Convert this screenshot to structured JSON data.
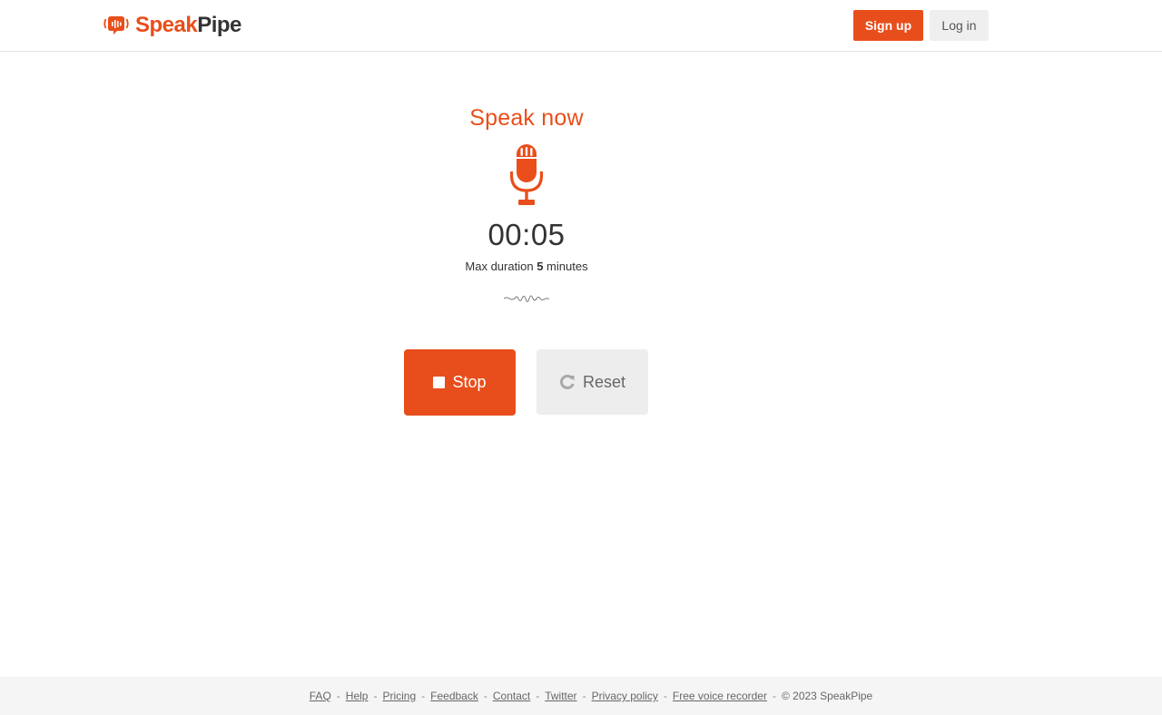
{
  "header": {
    "logo_speak": "Speak",
    "logo_pipe": "Pipe",
    "signup_label": "Sign up",
    "login_label": "Log in"
  },
  "recorder": {
    "heading": "Speak now",
    "timer": "00:05",
    "max_duration_prefix": "Max duration",
    "max_duration_value": "5",
    "max_duration_suffix": "minutes",
    "stop_label": "Stop",
    "reset_label": "Reset"
  },
  "footer": {
    "links": [
      "FAQ",
      "Help",
      "Pricing",
      "Feedback",
      "Contact",
      "Twitter",
      "Privacy policy",
      "Free voice recorder"
    ],
    "separator": "-",
    "copyright": "© 2023 SpeakPipe"
  },
  "colors": {
    "accent": "#e84e1c",
    "text": "#333333",
    "button_secondary": "#ededed"
  },
  "icons": {
    "logo": "speech-bubble-waveform-icon",
    "mic": "microphone-icon",
    "wave": "waveform-icon",
    "stop": "stop-square-icon",
    "reset": "refresh-icon"
  }
}
